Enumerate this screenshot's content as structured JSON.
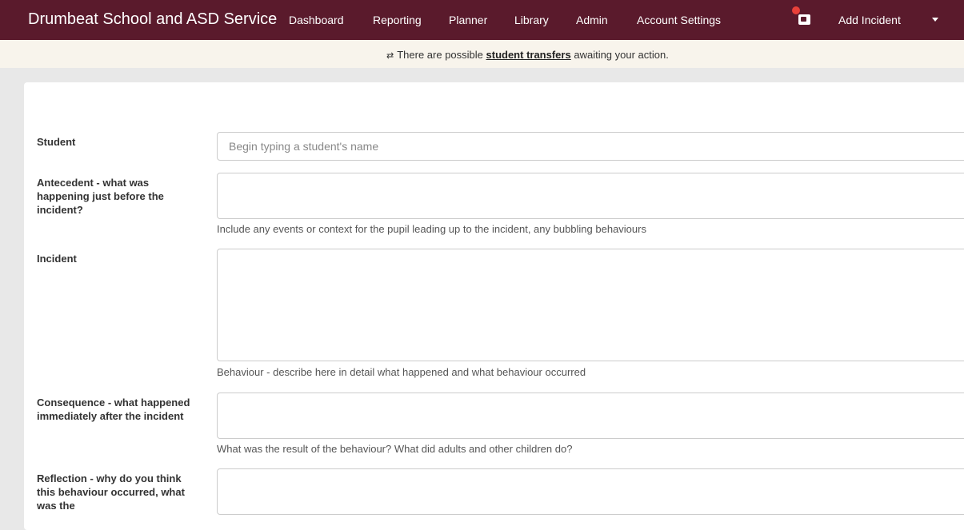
{
  "nav": {
    "brand": "Drumbeat School and ASD Service",
    "items": [
      "Dashboard",
      "Reporting",
      "Planner",
      "Library",
      "Admin",
      "Account Settings"
    ],
    "add_incident": "Add Incident"
  },
  "alert": {
    "icon": "transfer-arrows-icon",
    "prefix": "There are possible",
    "link": "student transfers",
    "suffix": "awaiting your action."
  },
  "form": {
    "student": {
      "label": "Student",
      "placeholder": "Begin typing a student's name"
    },
    "antecedent": {
      "label": "Antecedent - what was happening just before the incident?",
      "help": "Include any events or context for the pupil leading up to the incident, any bubbling behaviours"
    },
    "incident": {
      "label": "Incident",
      "help": "Behaviour - describe here in detail what happened and what behaviour occurred"
    },
    "consequence": {
      "label": "Consequence - what happened immediately after the incident",
      "help": "What was the result of the behaviour? What did adults and other children do?"
    },
    "reflection": {
      "label": "Reflection - why do you think this behaviour occurred, what was the"
    }
  },
  "colors": {
    "navbar": "#5a1a2c",
    "alert_bg": "#f8f4ec",
    "badge": "#e8413a"
  }
}
